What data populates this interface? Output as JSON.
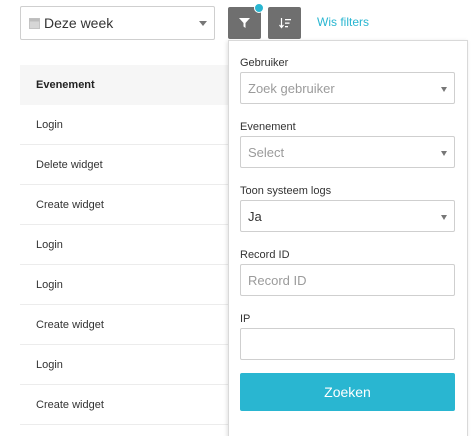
{
  "period_select": {
    "value": "Deze week",
    "icon": "calendar-icon"
  },
  "toolbar": {
    "filter_icon": "filter-icon",
    "sort_icon": "sort-icon",
    "clear_filters": "Wis filters",
    "accent": "#29b6d1"
  },
  "table": {
    "header": "Evenement",
    "rows": [
      "Login",
      "Delete widget",
      "Create widget",
      "Login",
      "Login",
      "Create widget",
      "Login",
      "Create widget"
    ]
  },
  "filter_panel": {
    "user": {
      "label": "Gebruiker",
      "placeholder": "Zoek gebruiker"
    },
    "event": {
      "label": "Evenement",
      "placeholder": "Select"
    },
    "system_logs": {
      "label": "Toon systeem logs",
      "value": "Ja"
    },
    "record_id": {
      "label": "Record ID",
      "placeholder": "Record ID"
    },
    "ip": {
      "label": "IP",
      "value": ""
    },
    "submit": "Zoeken"
  }
}
